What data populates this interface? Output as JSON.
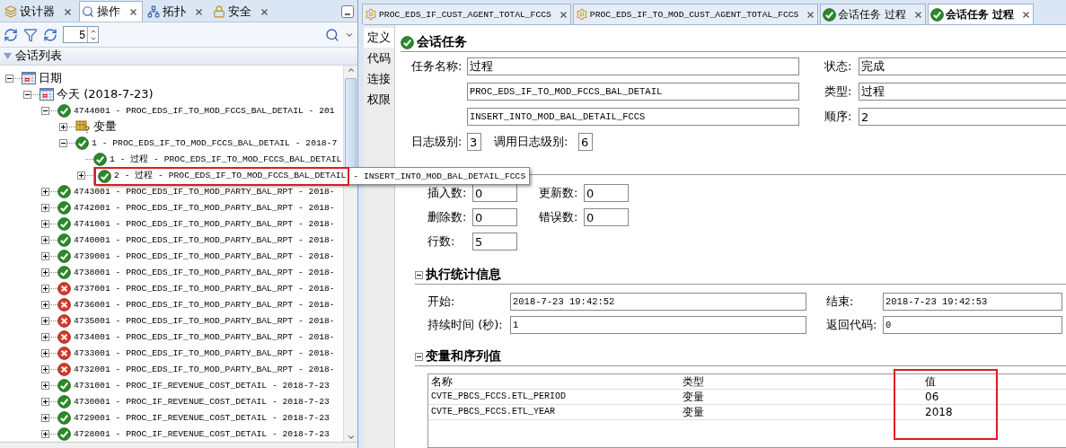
{
  "left_tabs": [
    {
      "label": "设计器",
      "kind": "designer",
      "selected": false
    },
    {
      "label": "操作",
      "kind": "operator",
      "selected": true
    },
    {
      "label": "拓扑",
      "kind": "topology",
      "selected": false
    },
    {
      "label": "安全",
      "kind": "security",
      "selected": false
    }
  ],
  "toolbar": {
    "spinner_value": "5"
  },
  "session_list": {
    "title": "会话列表",
    "expanded": true
  },
  "tree": [
    {
      "label": "日期",
      "kind": "date",
      "expanded": true,
      "children": [
        {
          "label": "今天 (2018-7-23)",
          "kind": "date",
          "expanded": true,
          "children": [
            {
              "label": "4744001 - PROC_EDS_IF_TO_MOD_FCCS_BAL_DETAIL - 201",
              "kind": "ok",
              "expanded": true,
              "children": [
                {
                  "label": "变量",
                  "kind": "variable",
                  "expanded": false
                },
                {
                  "label": "1 - PROC_EDS_IF_TO_MOD_FCCS_BAL_DETAIL - 2018-7",
                  "kind": "ok",
                  "expanded": true,
                  "children": [
                    {
                      "label": "1 - 过程 - PROC_EDS_IF_TO_MOD_FCCS_BAL_DETAIL",
                      "kind": "ok"
                    },
                    {
                      "label": "2 - 过程 - PROC_EDS_IF_TO_MOD_FCCS_BAL_DETAIL",
                      "kind": "ok",
                      "expanded": false,
                      "highlighted": true,
                      "tooltip": "- INSERT_INTO_MOD_BAL_DETAIL_FCCS"
                    }
                  ]
                }
              ]
            },
            {
              "label": "4743001 - PROC_EDS_IF_TO_MOD_PARTY_BAL_RPT - 2018-",
              "kind": "ok",
              "expanded": false
            },
            {
              "label": "4742001 - PROC_EDS_IF_TO_MOD_PARTY_BAL_RPT - 2018-",
              "kind": "ok",
              "expanded": false
            },
            {
              "label": "4741001 - PROC_EDS_IF_TO_MOD_PARTY_BAL_RPT - 2018-",
              "kind": "ok",
              "expanded": false
            },
            {
              "label": "4740001 - PROC_EDS_IF_TO_MOD_PARTY_BAL_RPT - 2018-",
              "kind": "ok",
              "expanded": false
            },
            {
              "label": "4739001 - PROC_EDS_IF_TO_MOD_PARTY_BAL_RPT - 2018-",
              "kind": "ok",
              "expanded": false
            },
            {
              "label": "4738001 - PROC_EDS_IF_TO_MOD_PARTY_BAL_RPT - 2018-",
              "kind": "ok",
              "expanded": false
            },
            {
              "label": "4737001 - PROC_EDS_IF_TO_MOD_PARTY_BAL_RPT - 2018-",
              "kind": "error",
              "expanded": false
            },
            {
              "label": "4736001 - PROC_EDS_IF_TO_MOD_PARTY_BAL_RPT - 2018-",
              "kind": "error",
              "expanded": false
            },
            {
              "label": "4735001 - PROC_EDS_IF_TO_MOD_PARTY_BAL_RPT - 2018-",
              "kind": "error",
              "expanded": false
            },
            {
              "label": "4734001 - PROC_EDS_IF_TO_MOD_PARTY_BAL_RPT - 2018-",
              "kind": "error",
              "expanded": false
            },
            {
              "label": "4733001 - PROC_EDS_IF_TO_MOD_PARTY_BAL_RPT - 2018-",
              "kind": "error",
              "expanded": false
            },
            {
              "label": "4732001 - PROC_EDS_IF_TO_MOD_PARTY_BAL_RPT - 2018-",
              "kind": "error",
              "expanded": false
            },
            {
              "label": "4731001 - PROC_IF_REVENUE_COST_DETAIL - 2018-7-23",
              "kind": "ok",
              "expanded": false
            },
            {
              "label": "4730001 - PROC_IF_REVENUE_COST_DETAIL - 2018-7-23",
              "kind": "ok",
              "expanded": false
            },
            {
              "label": "4729001 - PROC_IF_REVENUE_COST_DETAIL - 2018-7-23",
              "kind": "ok",
              "expanded": false
            },
            {
              "label": "4728001 - PROC_IF_REVENUE_COST_DETAIL - 2018-7-23",
              "kind": "ok",
              "expanded": false
            }
          ]
        }
      ]
    }
  ],
  "editor_tabs": [
    {
      "label": "PROC_EDS_IF_CUST_AGENT_TOTAL_FCCS",
      "kind": "gear",
      "selected": false
    },
    {
      "label": "PROC_EDS_IF_TO_MOD_CUST_AGENT_TOTAL_FCCS",
      "kind": "gear",
      "selected": false
    },
    {
      "label": "会话任务 过程",
      "kind": "check",
      "selected": false
    },
    {
      "label": "会话任务 过程",
      "kind": "check",
      "selected": true
    }
  ],
  "side_tabs": [
    {
      "label": "定义",
      "selected": true
    },
    {
      "label": "代码",
      "selected": false
    },
    {
      "label": "连接",
      "selected": false
    },
    {
      "label": "权限",
      "selected": false
    }
  ],
  "task": {
    "title": "会话任务",
    "name_label": "任务名称:",
    "name": "过程",
    "line2": "PROC_EDS_IF_TO_MOD_FCCS_BAL_DETAIL",
    "line3": "INSERT_INTO_MOD_BAL_DETAIL_FCCS",
    "status_label": "状态:",
    "status": "完成",
    "type_label": "类型:",
    "type": "过程",
    "order_label": "顺序:",
    "order": "2",
    "log_level_label": "日志级别:",
    "log_level": "3",
    "call_log_level_label": "调用日志级别:",
    "call_log_level": "6"
  },
  "counts": [
    [
      {
        "label": "插入数:",
        "value": "0"
      },
      {
        "label": "更新数:",
        "value": "0"
      }
    ],
    [
      {
        "label": "删除数:",
        "value": "0"
      },
      {
        "label": "错误数:",
        "value": "0"
      }
    ],
    [
      {
        "label": "行数:",
        "value": "5"
      }
    ]
  ],
  "execution": {
    "title": "执行统计信息",
    "expanded": true,
    "start_label": "开始:",
    "start": "2018-7-23 19:42:52",
    "end_label": "结束:",
    "end": "2018-7-23 19:42:53",
    "duration_label": "持续时间 (秒):",
    "duration": "1",
    "return_label": "返回代码:",
    "return_code": "0"
  },
  "variables": {
    "title": "变量和序列值",
    "expanded": true,
    "columns": [
      {
        "label": "名称",
        "highlighted": false
      },
      {
        "label": "类型",
        "highlighted": false
      },
      {
        "label": "值",
        "highlighted": true
      }
    ],
    "rows": [
      [
        "CVTE_PBCS_FCCS.ETL_PERIOD",
        "变量",
        "06"
      ],
      [
        "CVTE_PBCS_FCCS.ETL_YEAR",
        "变量",
        "2018"
      ]
    ]
  }
}
